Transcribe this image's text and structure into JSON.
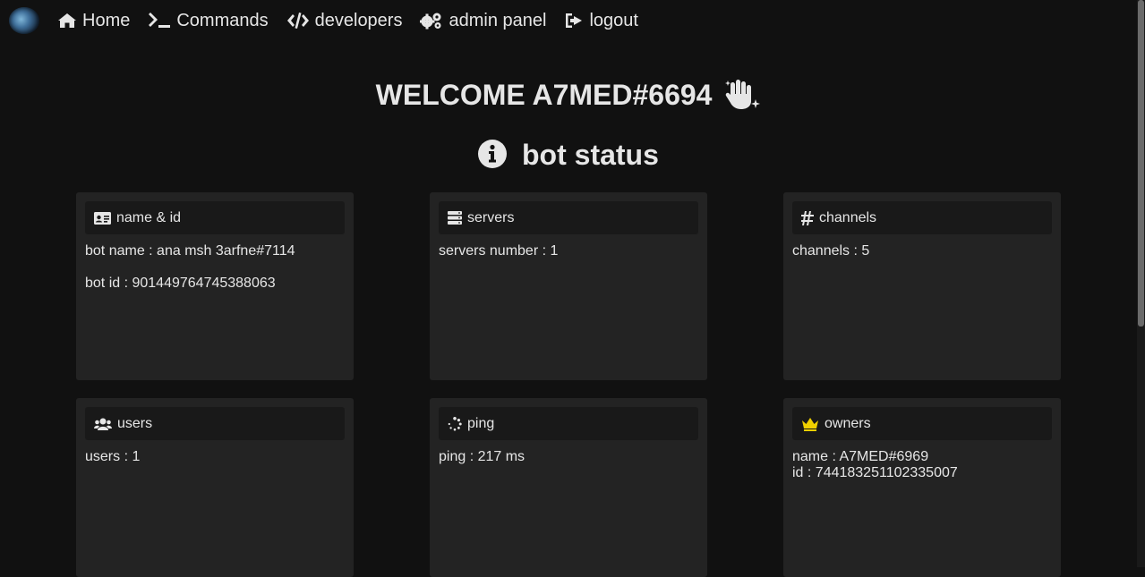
{
  "nav": {
    "home": "Home",
    "commands": "Commands",
    "developers": "developers",
    "admin_panel": "admin panel",
    "logout": "logout"
  },
  "welcome": "WELCOME A7MED#6694",
  "status_title": "bot status",
  "cards": {
    "name_id": {
      "title": "name & id",
      "line1": "bot name : ana msh 3arfne#7114",
      "line2": "bot id : 901449764745388063"
    },
    "servers": {
      "title": "servers",
      "line1": "servers number : 1"
    },
    "channels": {
      "title": "channels",
      "line1": "channels : 5"
    },
    "users": {
      "title": "users",
      "line1": "users : 1"
    },
    "ping": {
      "title": "ping",
      "line1": "ping : 217 ms"
    },
    "owners": {
      "title": "owners",
      "line1": "name : A7MED#6969",
      "line2": "id : 744183251102335007"
    }
  },
  "colors": {
    "background": "#111111",
    "card": "#232323",
    "card_header": "#191919",
    "text": "#e6e6e6",
    "crown": "#f0d000"
  },
  "icons": [
    "home-icon",
    "terminal-icon",
    "code-icon",
    "cogs-icon",
    "sign-out-icon",
    "hand-sparkles-icon",
    "info-circle-icon",
    "id-card-icon",
    "server-icon",
    "hashtag-icon",
    "users-icon",
    "spinner-icon",
    "crown-icon"
  ]
}
